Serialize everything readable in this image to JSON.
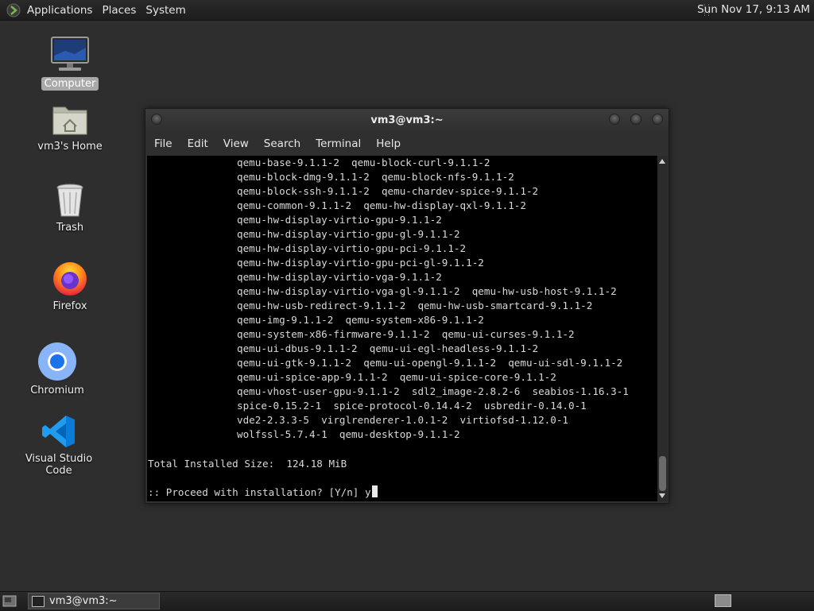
{
  "top_panel": {
    "menus": [
      "Applications",
      "Places",
      "System"
    ],
    "clock": "Sun Nov 17,  9:13 AM"
  },
  "desktop": {
    "icons": [
      {
        "label": "Computer",
        "icon": "computer-icon",
        "selected": true
      },
      {
        "label": "vm3's Home",
        "icon": "home-folder-icon"
      },
      {
        "label": "Trash",
        "icon": "trash-icon"
      },
      {
        "label": "Firefox",
        "icon": "firefox-icon"
      },
      {
        "label": "Chromium",
        "icon": "chromium-icon"
      },
      {
        "label": "Visual Studio Code",
        "icon": "vscode-icon"
      }
    ]
  },
  "window": {
    "title": "vm3@vm3:~",
    "menu": [
      "File",
      "Edit",
      "View",
      "Search",
      "Terminal",
      "Help"
    ],
    "terminal": {
      "package_lines": [
        "qemu-base-9.1.1-2  qemu-block-curl-9.1.1-2",
        "qemu-block-dmg-9.1.1-2  qemu-block-nfs-9.1.1-2",
        "qemu-block-ssh-9.1.1-2  qemu-chardev-spice-9.1.1-2",
        "qemu-common-9.1.1-2  qemu-hw-display-qxl-9.1.1-2",
        "qemu-hw-display-virtio-gpu-9.1.1-2",
        "qemu-hw-display-virtio-gpu-gl-9.1.1-2",
        "qemu-hw-display-virtio-gpu-pci-9.1.1-2",
        "qemu-hw-display-virtio-gpu-pci-gl-9.1.1-2",
        "qemu-hw-display-virtio-vga-9.1.1-2",
        "qemu-hw-display-virtio-vga-gl-9.1.1-2  qemu-hw-usb-host-9.1.1-2",
        "qemu-hw-usb-redirect-9.1.1-2  qemu-hw-usb-smartcard-9.1.1-2",
        "qemu-img-9.1.1-2  qemu-system-x86-9.1.1-2",
        "qemu-system-x86-firmware-9.1.1-2  qemu-ui-curses-9.1.1-2",
        "qemu-ui-dbus-9.1.1-2  qemu-ui-egl-headless-9.1.1-2",
        "qemu-ui-gtk-9.1.1-2  qemu-ui-opengl-9.1.1-2  qemu-ui-sdl-9.1.1-2",
        "qemu-ui-spice-app-9.1.1-2  qemu-ui-spice-core-9.1.1-2",
        "qemu-vhost-user-gpu-9.1.1-2  sdl2_image-2.8.2-6  seabios-1.16.3-1",
        "spice-0.15.2-1  spice-protocol-0.14.4-2  usbredir-0.14.0-1",
        "vde2-2.3.3-5  virglrenderer-1.0.1-2  virtiofsd-1.12.0-1",
        "wolfssl-5.7.4-1  qemu-desktop-9.1.1-2"
      ],
      "total_line": "Total Installed Size:  124.18 MiB",
      "prompt": ":: Proceed with installation? [Y/n] ",
      "input": "y"
    }
  },
  "taskbar": {
    "task_label": "vm3@vm3:~"
  }
}
